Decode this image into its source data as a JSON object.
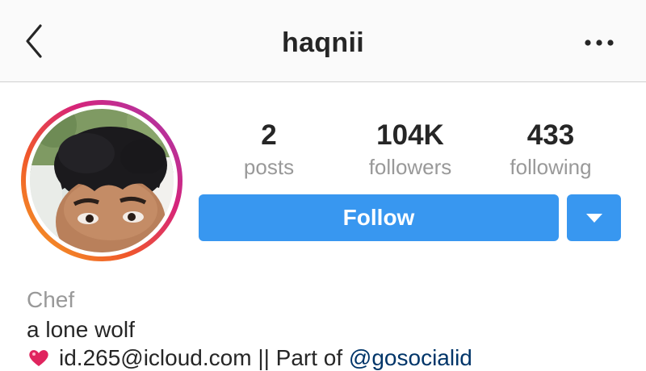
{
  "header": {
    "title": "haqnii"
  },
  "profile": {
    "stats": [
      {
        "value": "2",
        "label": "posts"
      },
      {
        "value": "104K",
        "label": "followers"
      },
      {
        "value": "433",
        "label": "following"
      }
    ],
    "follow_label": "Follow",
    "category": "Chef",
    "bio_line1": "a lone wolf",
    "bio_line2_text": "id.265@icloud.com || Part of ",
    "bio_line2_mention": "@gosocialid"
  },
  "colors": {
    "accent": "#3897f0",
    "muted_text": "#999999",
    "primary_text": "#262626",
    "mention": "#003569"
  },
  "icons": {
    "back": "chevron-left-icon",
    "more": "more-horizontal-icon",
    "dropdown": "triangle-down-icon",
    "bio_emoji": "sparkling-heart-emoji"
  }
}
